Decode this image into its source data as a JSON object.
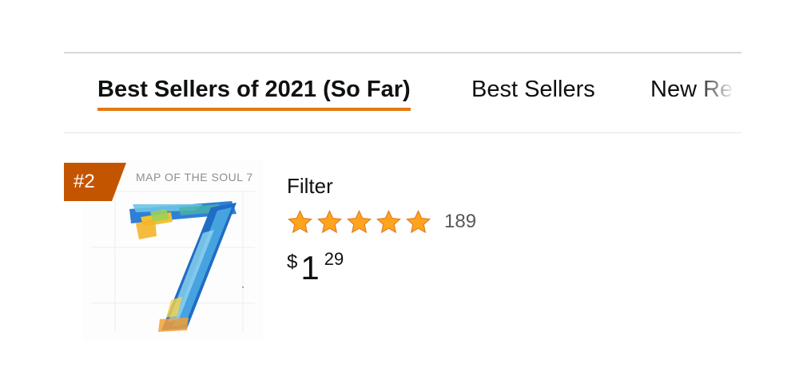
{
  "tabs": [
    {
      "label": "Best Sellers of 2021 (So Far)",
      "active": true
    },
    {
      "label": "Best Sellers",
      "active": false
    },
    {
      "label": "New Rel",
      "active": false
    }
  ],
  "product": {
    "rank": "#2",
    "cover_text": "MAP OF THE SOUL  7",
    "title": "Filter",
    "rating_stars": 5,
    "rating_count": "189",
    "price": {
      "symbol": "$",
      "whole": "1",
      "fraction": "29"
    }
  },
  "colors": {
    "accent_underline": "#e47911",
    "rank_badge": "#c45500",
    "star": "#ffa41c"
  },
  "icons": [
    "star-icon"
  ]
}
